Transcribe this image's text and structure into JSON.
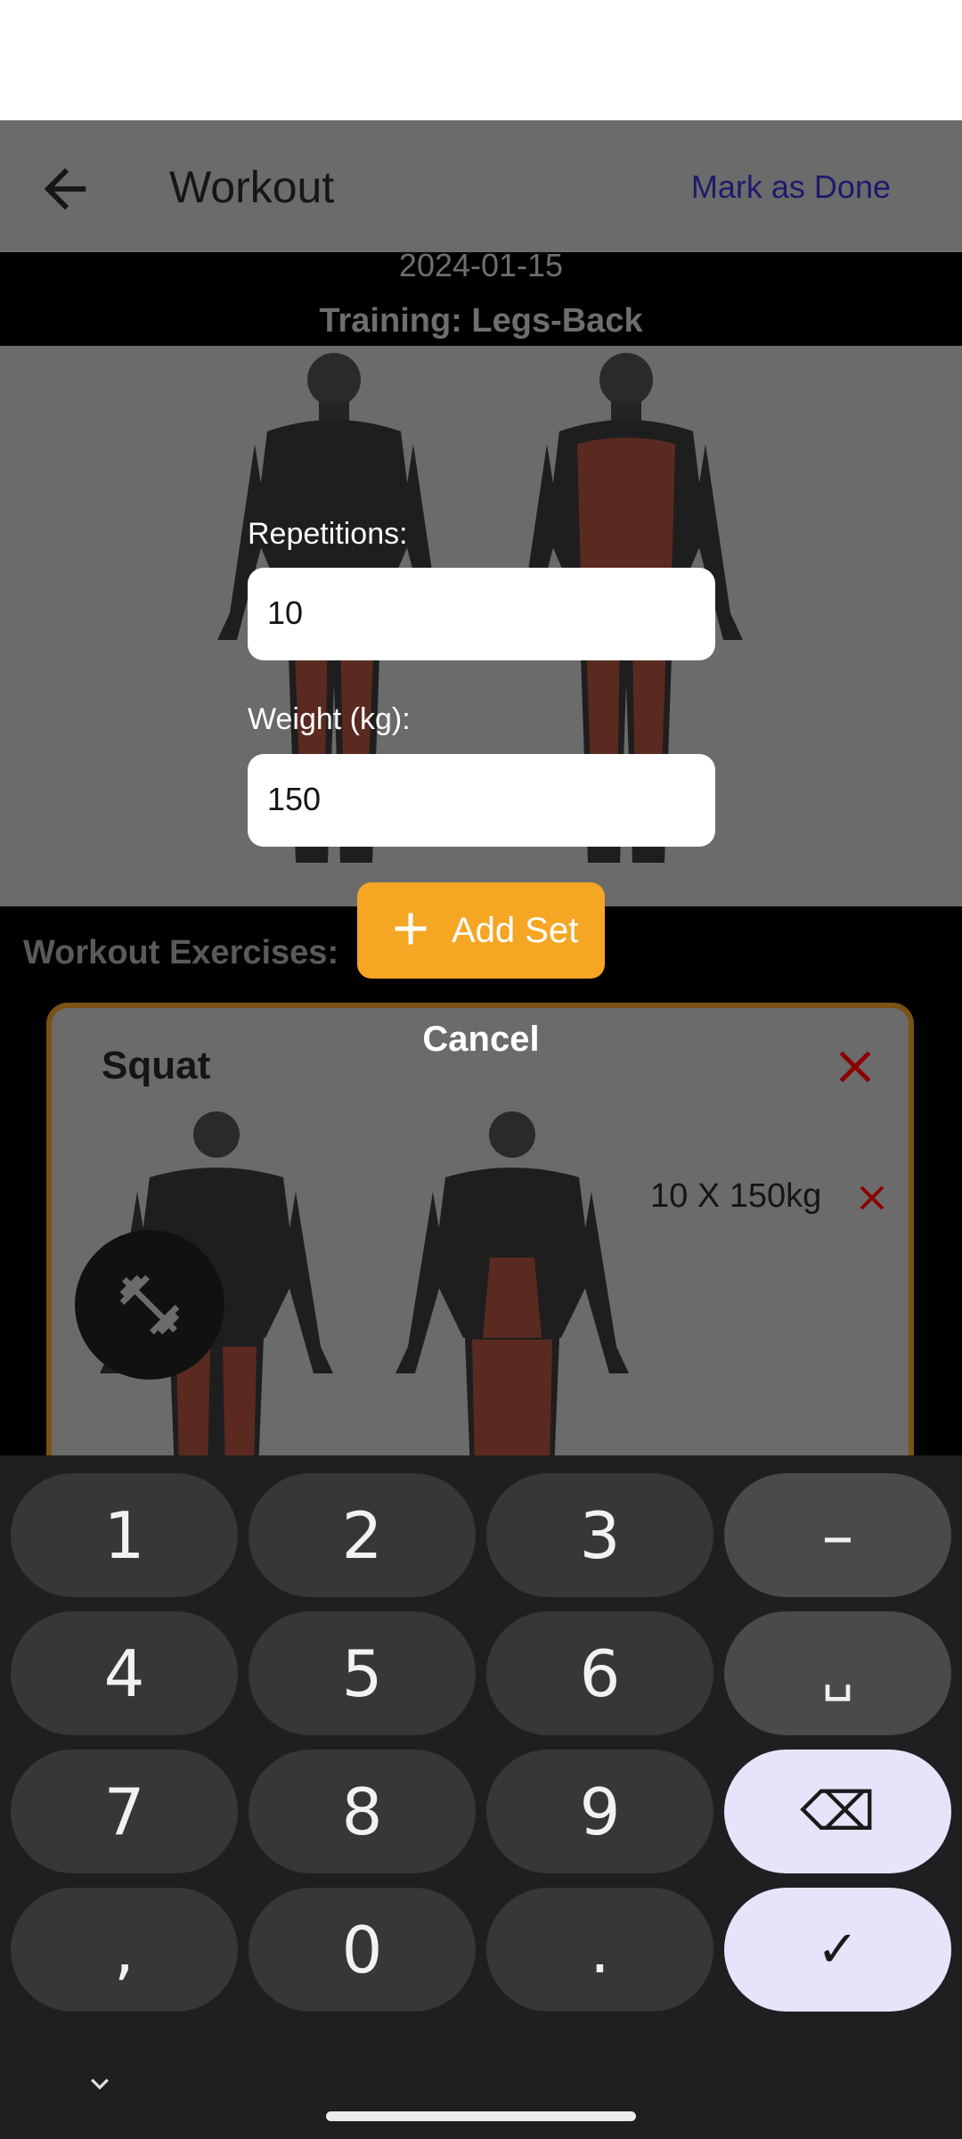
{
  "appbar": {
    "title": "Workout",
    "action_label": "Mark as Done",
    "back_icon": "arrow-back-icon"
  },
  "session": {
    "date": "2024-01-15",
    "training": "Training: Legs-Back"
  },
  "section": {
    "title": "Workout Exercises:"
  },
  "exercise": {
    "name": "Squat",
    "sets": [
      {
        "label": "10 X 150kg"
      }
    ]
  },
  "dialog": {
    "repetitions_label": "Repetitions:",
    "repetitions_value": "10",
    "weight_label": "Weight (kg):",
    "weight_value": "150",
    "add_button": "Add Set",
    "cancel_button": "Cancel"
  },
  "keyboard": {
    "keys": [
      "1",
      "2",
      "3",
      "–",
      "4",
      "5",
      "6",
      "␣",
      "7",
      "8",
      "9",
      "⌫",
      ",",
      "0",
      ".",
      "✓"
    ]
  },
  "colors": {
    "accent": "#f5a623",
    "muscle_highlight": "#6b2a20",
    "delete": "#8b0000",
    "card_border": "#7a5214"
  }
}
